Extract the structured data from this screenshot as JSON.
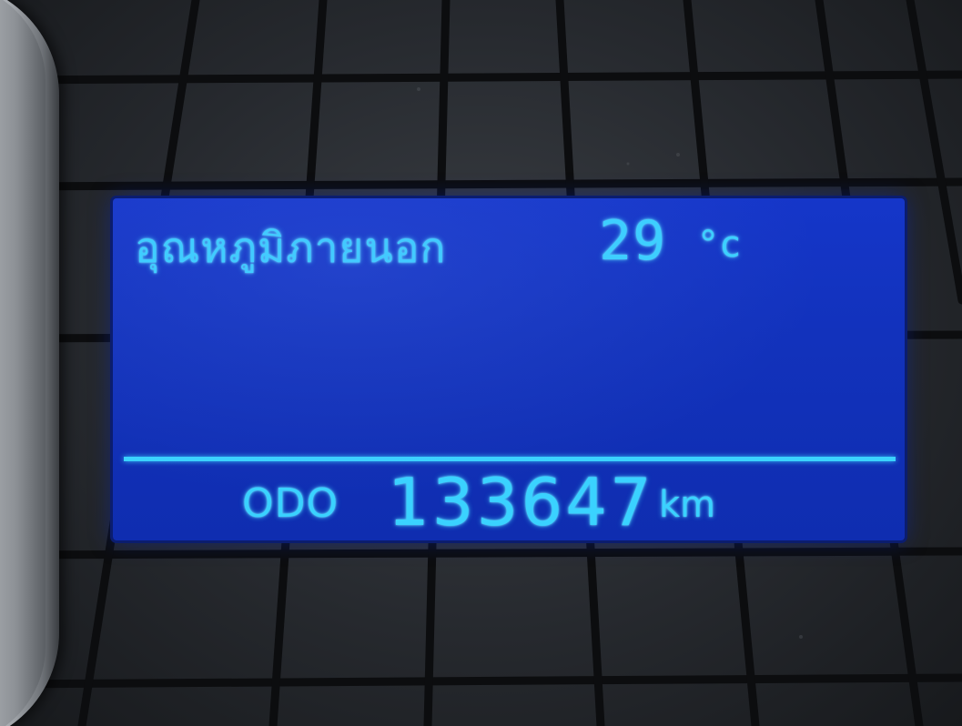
{
  "display": {
    "outside_temp_label": "อุณหภูมิภายนอก",
    "outside_temp_value": "29",
    "outside_temp_unit": "°c",
    "odometer_label": "ODO",
    "odometer_value": "133647",
    "odometer_unit": "km"
  },
  "colors": {
    "lcd_background": "#1232bc",
    "lcd_text": "#3ad2ff",
    "panel_background": "#26292e",
    "grid_lines": "#0c0d0f"
  }
}
